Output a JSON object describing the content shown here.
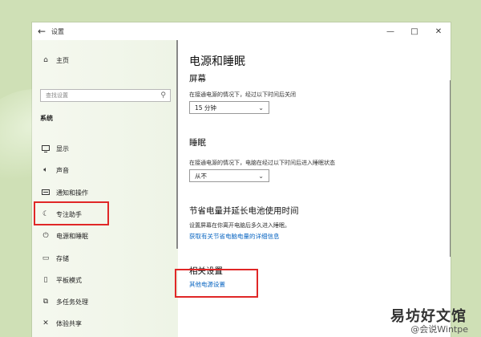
{
  "window": {
    "title": "设置",
    "back_icon": "←",
    "controls": {
      "minimize": "—",
      "maximize": "□",
      "close": "✕"
    }
  },
  "sidebar": {
    "home_label": "主页",
    "search_placeholder": "查找设置",
    "section_title": "系统",
    "items": [
      {
        "label": "显示",
        "icon": "monitor-icon"
      },
      {
        "label": "声音",
        "icon": "speaker-icon"
      },
      {
        "label": "通知和操作",
        "icon": "notification-icon"
      },
      {
        "label": "专注助手",
        "icon": "moon-icon"
      },
      {
        "label": "电源和睡眠",
        "icon": "power-icon"
      },
      {
        "label": "存储",
        "icon": "storage-icon"
      },
      {
        "label": "平板模式",
        "icon": "tablet-icon"
      },
      {
        "label": "多任务处理",
        "icon": "multitask-icon"
      },
      {
        "label": "体验共享",
        "icon": "share-icon"
      }
    ]
  },
  "content": {
    "page_title": "电源和睡眠",
    "screen": {
      "heading": "屏幕",
      "description": "在接通电源的情况下，经过以下时间后关闭",
      "value": "15 分钟"
    },
    "sleep": {
      "heading": "睡眠",
      "description": "在接通电源的情况下，电脑在经过以下时间后进入睡眠状态",
      "value": "从不"
    },
    "battery": {
      "heading": "节省电量并延长电池使用时间",
      "description": "设置屏幕在你离开电脑后多久进入睡眠。",
      "link": "获取有关节省电脑电量的详细信息"
    },
    "related": {
      "heading": "相关设置",
      "link": "其他电源设置"
    }
  },
  "watermark": {
    "main": "易坊好文馆",
    "sub": "@会说Wintpe"
  },
  "colors": {
    "accent": "#0a66c2",
    "highlight": "#e02727",
    "background": "#cfe0b6"
  }
}
